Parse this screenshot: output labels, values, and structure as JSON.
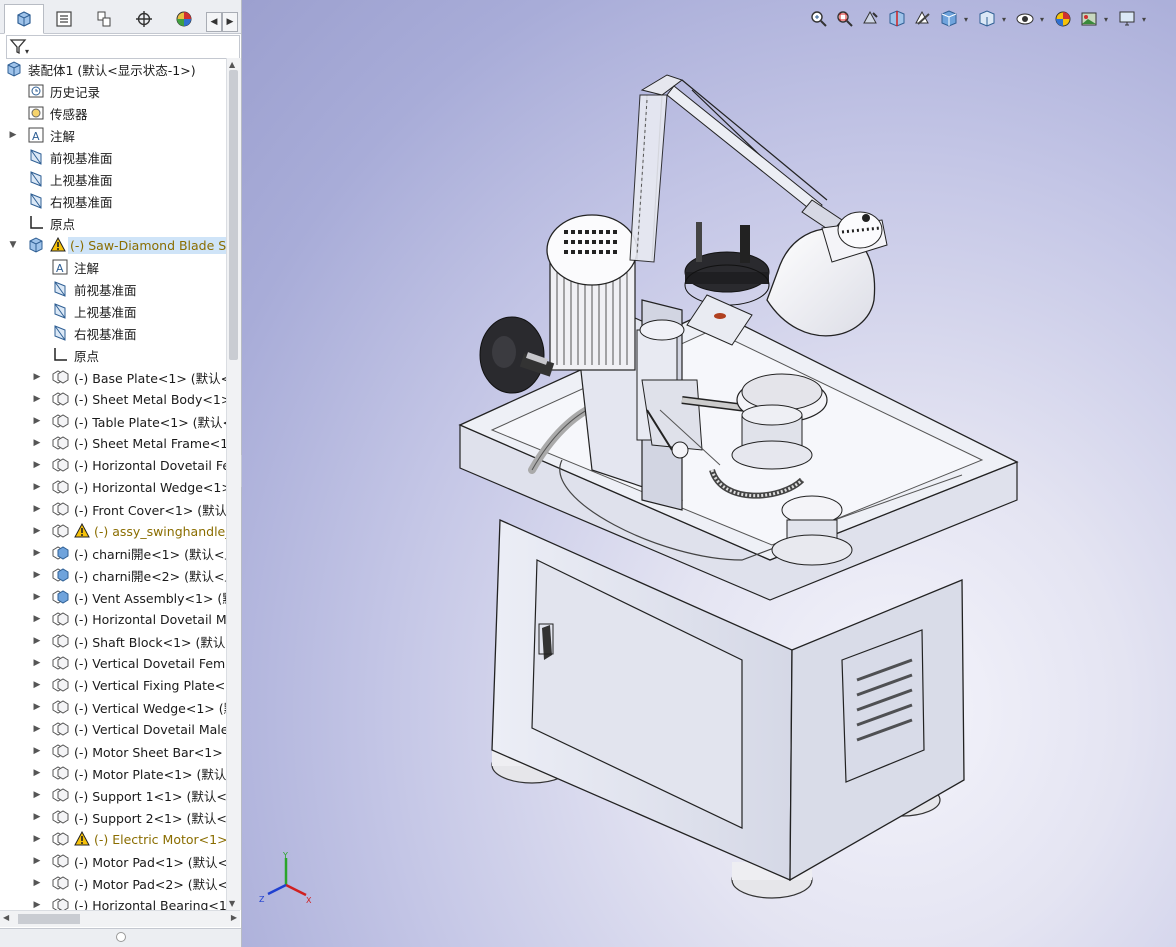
{
  "manager_tabs": [
    "feature-manager",
    "property-manager",
    "configuration-manager",
    "dimxpert-manager",
    "display-manager"
  ],
  "filter": {
    "icon": "filter-icon",
    "dropdown": "▾"
  },
  "tree": {
    "root": "装配体1  (默认<显示状态-1>)",
    "top_items": [
      {
        "label": "历史记录",
        "icon": "history-icon"
      },
      {
        "label": "传感器",
        "icon": "sensor-icon"
      },
      {
        "label": "注解",
        "icon": "annotation-icon"
      },
      {
        "label": "前视基准面",
        "icon": "plane-icon"
      },
      {
        "label": "上视基准面",
        "icon": "plane-icon"
      },
      {
        "label": "右视基准面",
        "icon": "plane-icon"
      },
      {
        "label": "原点",
        "icon": "origin-icon"
      }
    ],
    "selected_assembly": "(-) Saw-Diamond Blade Sh",
    "sub_items": [
      {
        "label": "注解"
      },
      {
        "label": "前视基准面"
      },
      {
        "label": "上视基准面"
      },
      {
        "label": "右视基准面"
      },
      {
        "label": "原点"
      }
    ],
    "components": [
      {
        "label": "(-) Base Plate<1> (默认<<",
        "warn": false,
        "sub": false
      },
      {
        "label": "(-) Sheet Metal Body<1>",
        "warn": false,
        "sub": false
      },
      {
        "label": "(-) Table Plate<1> (默认<",
        "warn": false,
        "sub": false
      },
      {
        "label": "(-) Sheet Metal Frame<1>",
        "warn": false,
        "sub": false
      },
      {
        "label": "(-) Horizontal Dovetail Fer",
        "warn": false,
        "sub": false
      },
      {
        "label": "(-) Horizontal Wedge<1>",
        "warn": false,
        "sub": false
      },
      {
        "label": "(-) Front Cover<1> (默认<",
        "warn": false,
        "sub": false
      },
      {
        "label": "(-) assy_swinghandle_",
        "warn": true,
        "sub": false
      },
      {
        "label": "(-) charni開e<1> (默认<显",
        "warn": false,
        "sub": true
      },
      {
        "label": "(-) charni開e<2> (默认<显",
        "warn": false,
        "sub": true
      },
      {
        "label": "(-) Vent Assembly<1> (默",
        "warn": false,
        "sub": true
      },
      {
        "label": "(-) Horizontal Dovetail Ma",
        "warn": false,
        "sub": false
      },
      {
        "label": "(-) Shaft Block<1> (默认<",
        "warn": false,
        "sub": false
      },
      {
        "label": "(-) Vertical Dovetail Femal",
        "warn": false,
        "sub": false
      },
      {
        "label": "(-) Vertical Fixing Plate<1>",
        "warn": false,
        "sub": false
      },
      {
        "label": "(-) Vertical Wedge<1> (默",
        "warn": false,
        "sub": false
      },
      {
        "label": "(-) Vertical Dovetail Male<",
        "warn": false,
        "sub": false
      },
      {
        "label": "(-) Motor Sheet Bar<1> (默",
        "warn": false,
        "sub": false
      },
      {
        "label": "(-) Motor Plate<1> (默认<",
        "warn": false,
        "sub": false
      },
      {
        "label": "(-) Support 1<1> (默认<<",
        "warn": false,
        "sub": false
      },
      {
        "label": "(-) Support 2<1> (默认<<",
        "warn": false,
        "sub": false
      },
      {
        "label": "(-) Electric Motor<1>",
        "warn": true,
        "sub": false
      },
      {
        "label": "(-) Motor Pad<1> (默认<<",
        "warn": false,
        "sub": false
      },
      {
        "label": "(-) Motor Pad<2> (默认<<",
        "warn": false,
        "sub": false
      },
      {
        "label": "(-) Horizontal Bearing<1>",
        "warn": false,
        "sub": false
      }
    ]
  },
  "viewport_tools": [
    "zoom-to-fit-icon",
    "zoom-to-area-icon",
    "previous-view-icon",
    "section-view-icon",
    "dynamic-annotation-icon",
    "view-orientation-icon",
    "display-style-icon",
    "hide-show-icon",
    "edit-appearance-icon",
    "apply-scene-icon",
    "view-settings-icon"
  ],
  "triad": {
    "x": "X",
    "y": "Y",
    "z": "Z"
  },
  "colors": {
    "selection": "#cfe4f8",
    "warning_text": "#8a6d00",
    "viewport_top": "#9ca0cf",
    "viewport_bottom": "#f4f4fb"
  }
}
